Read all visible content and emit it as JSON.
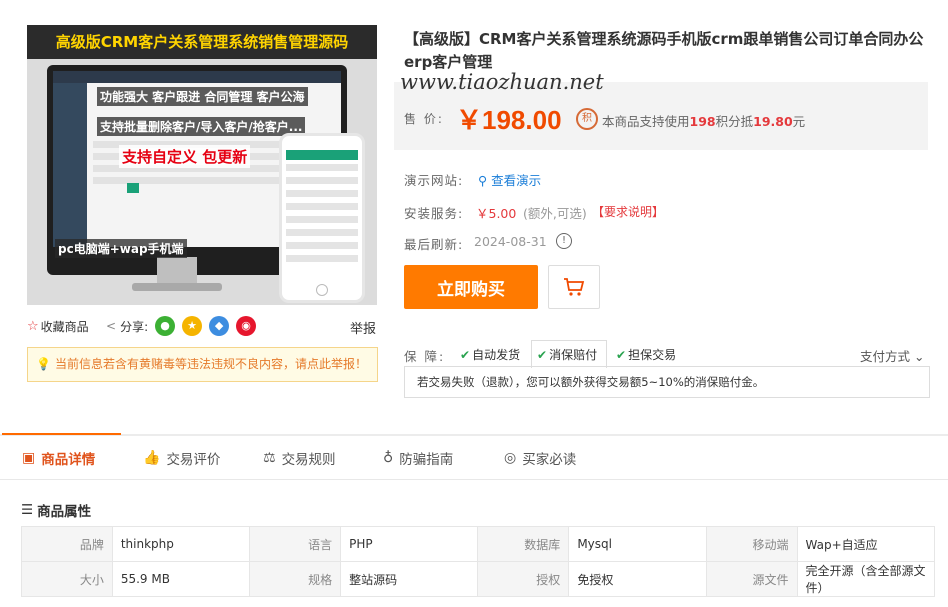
{
  "hero_image": {
    "banner": "高级版CRM客户关系管理系统销售管理源码",
    "line1": "功能强大 客户跟进 合同管理 客户公海",
    "line2": "支持批量删除客户/导入客户/抢客户...",
    "line3": "支持自定义 包更新",
    "line4": "pc电脑端+wap手机端"
  },
  "image_bar": {
    "favorite": "收藏商品",
    "share": "分享:",
    "report": "举报"
  },
  "notice": "当前信息若含有黄赌毒等违法违规不良内容，请点此举报！",
  "product": {
    "title": "【高级版】CRM客户关系管理系统源码手机版crm跟单销售公司订单合同办公erp客户管理",
    "watermark": "www.tiaozhuan.net",
    "price_label": "售 价:",
    "price": "￥198.00",
    "points_icon": "积",
    "points_prefix": "本商品支持使用",
    "points_amount": "198",
    "points_mid": "积分抵",
    "points_value": "19.80",
    "points_suffix": "元"
  },
  "info_rows": {
    "demo_label": "演示网站:",
    "demo_link": "查看演示",
    "service_label": "安装服务:",
    "service_price": "￥5.00",
    "service_optional": "(额外,可选)",
    "service_note": "【要求说明】",
    "refresh_label": "最后刷新:",
    "refresh_date": "2024-08-31"
  },
  "actions": {
    "buy": "立即购买"
  },
  "guarantee": {
    "label": "保 障:",
    "items": [
      "自动发货",
      "消保赔付",
      "担保交易"
    ],
    "pay_method": "支付方式",
    "description": "若交易失败（退款），您可以额外获得交易额5~10%的消保赔付金。"
  },
  "tabs": [
    "商品详情",
    "交易评价",
    "交易规则",
    "防骗指南",
    "买家必读"
  ],
  "attributes": {
    "title": "商品属性",
    "rows": [
      [
        [
          "品牌",
          "thinkphp"
        ],
        [
          "语言",
          "PHP"
        ],
        [
          "数据库",
          "Mysql"
        ],
        [
          "移动端",
          "Wap+自适应"
        ]
      ],
      [
        [
          "大小",
          "55.9 MB"
        ],
        [
          "规格",
          "整站源码"
        ],
        [
          "授权",
          "免授权"
        ],
        [
          "源文件",
          "完全开源（含全部源文件）"
        ]
      ]
    ]
  },
  "colors": {
    "price": "#f04a00",
    "buy_button": "#ff7a00",
    "tab_active": "#e0541d",
    "link": "#1b7ed8",
    "notice_bg": "#fffbe5",
    "wechat": "#3cb034",
    "qzone": "#f5b400",
    "qq": "#3d8de0",
    "weibo": "#e6162d"
  }
}
